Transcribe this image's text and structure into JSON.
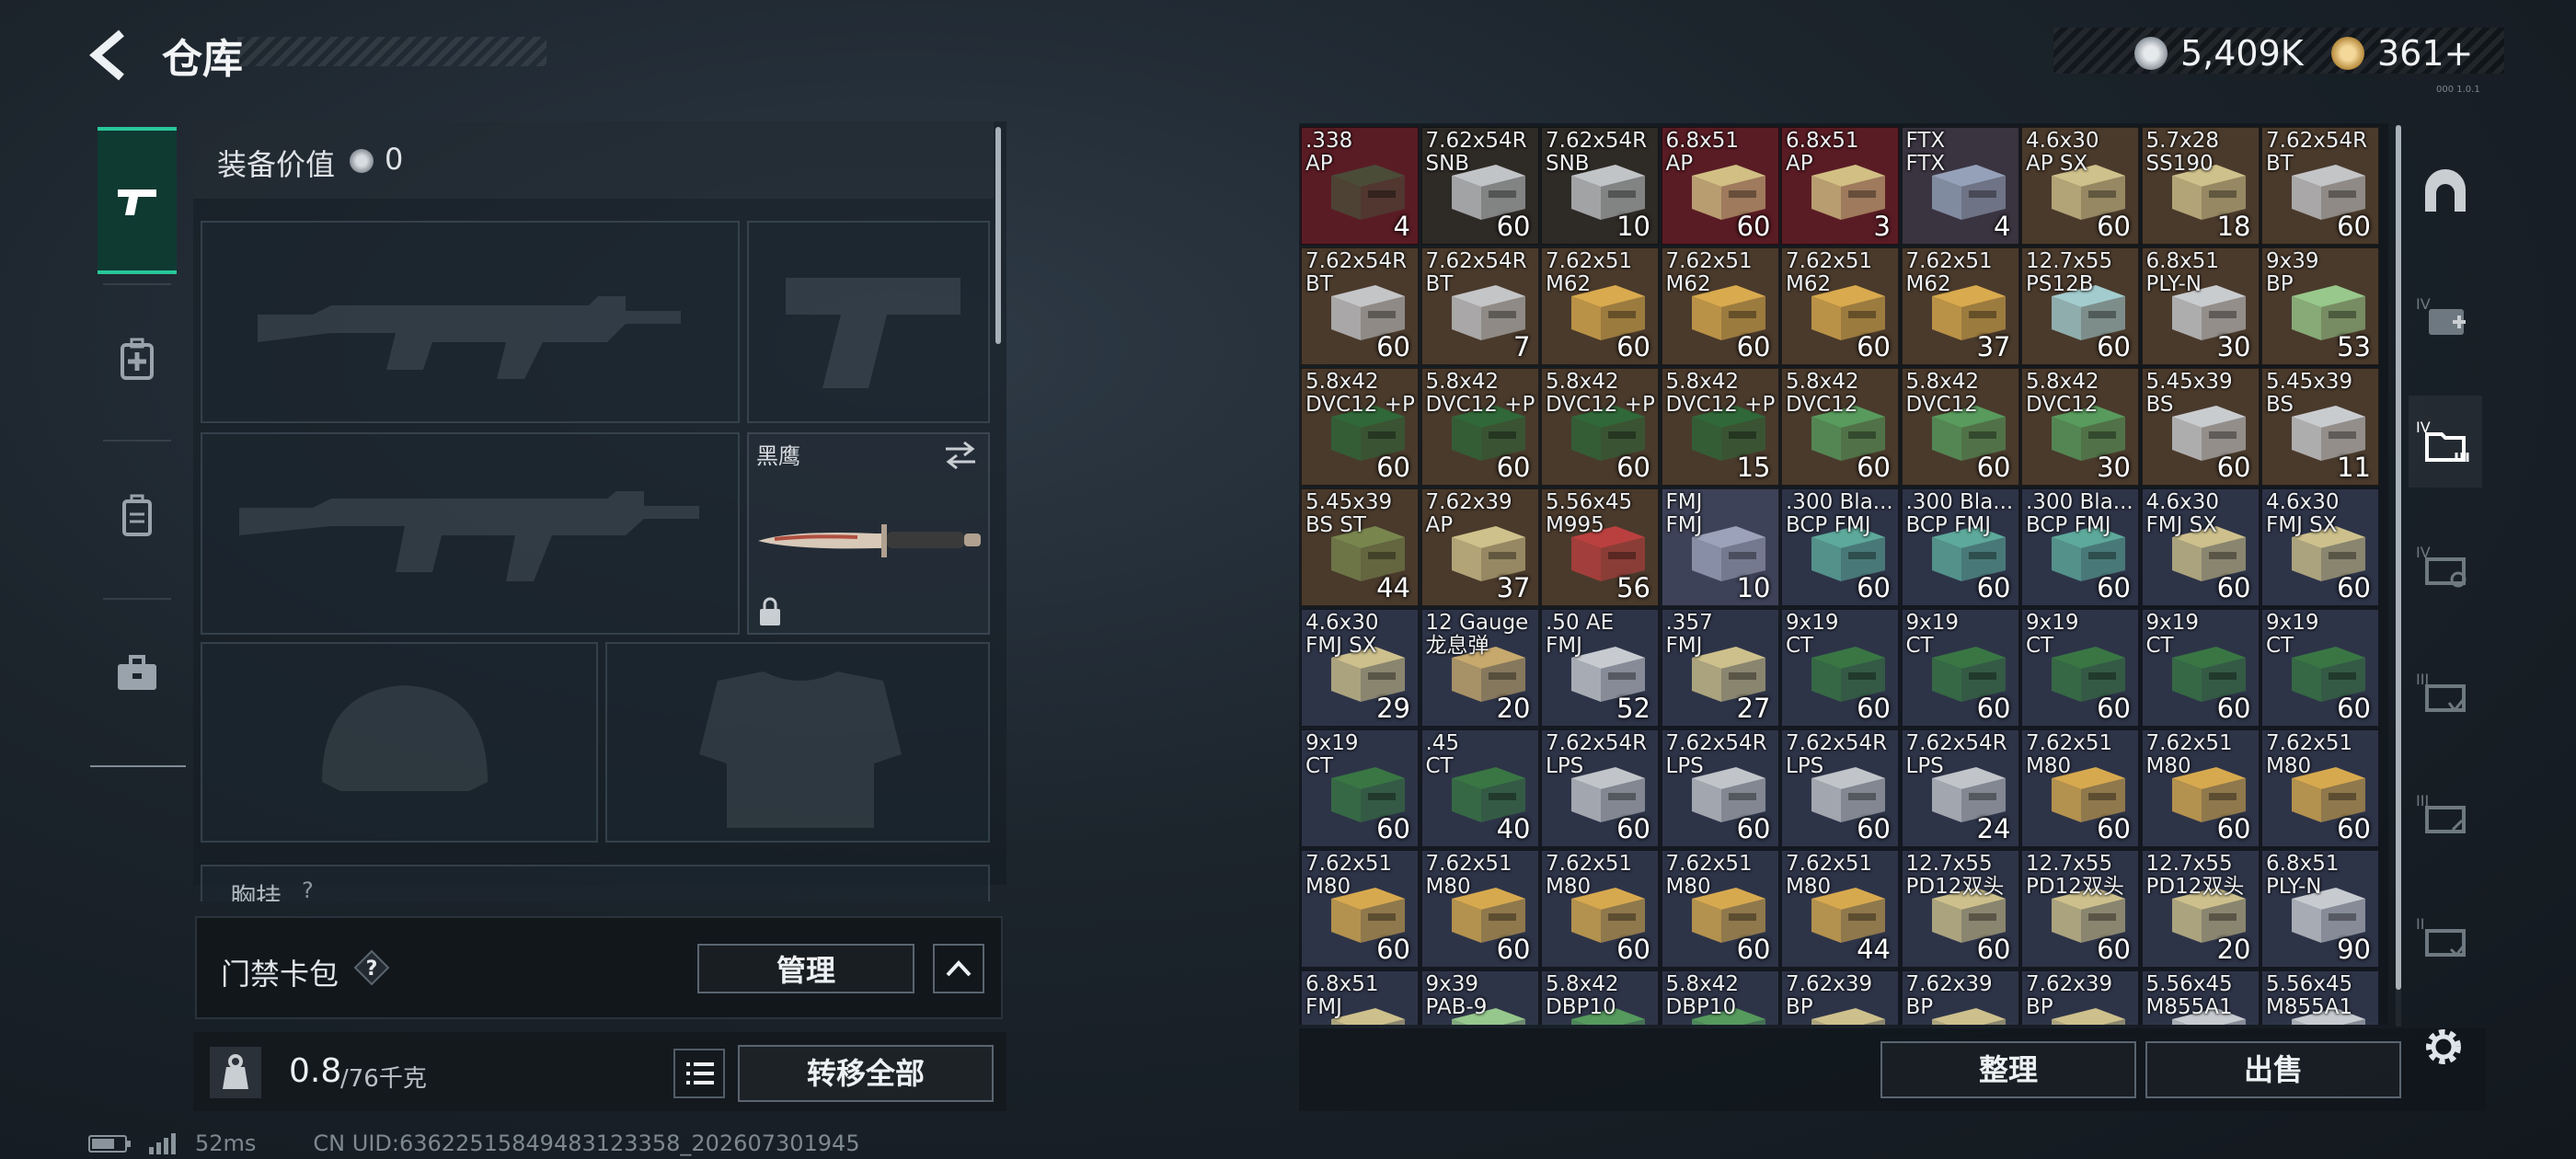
{
  "header": {
    "title": "仓库"
  },
  "currency": {
    "silver": "5,409K",
    "gold": "361+",
    "gold_add": "+"
  },
  "version": "000 1.0.1",
  "equipment": {
    "value_label": "装备价值",
    "value": "0",
    "knife_name": "黑鹰",
    "chest_label": "胸挂",
    "chest_help": "?"
  },
  "card_pack": {
    "label": "门禁卡包",
    "help": "?",
    "manage": "管理"
  },
  "weight": {
    "current": "0.8",
    "max": "/76千克"
  },
  "actions": {
    "transfer_all": "转移全部",
    "sort": "整理",
    "sell": "出售"
  },
  "status": {
    "ping": "52ms",
    "uid": "CN UID:63622515849483123358_202607301945"
  },
  "colors": {
    "accent": "#29c79a",
    "bg": "#1c242c"
  },
  "storage": {
    "items": [
      {
        "name": ".338\nAP",
        "qty": "4",
        "bg": "#5a1c24",
        "box": "#4a4f3a"
      },
      {
        "name": "7.62x54R\nSNB",
        "qty": "60",
        "bg": "#2e2a26",
        "box": "#c9ccd0"
      },
      {
        "name": "7.62x54R\nSNB",
        "qty": "10",
        "bg": "#2e2a26",
        "box": "#c9ccd0"
      },
      {
        "name": "6.8x51\nAP",
        "qty": "60",
        "bg": "#5a1c24",
        "box": "#d8c88a"
      },
      {
        "name": "6.8x51\nAP",
        "qty": "3",
        "bg": "#5a1c24",
        "box": "#d8c88a"
      },
      {
        "name": "FTX\nFTX",
        "qty": "4",
        "bg": "#3a3440",
        "box": "#9aa8c0"
      },
      {
        "name": "4.6x30\nAP SX",
        "qty": "60",
        "bg": "#4a3a2c",
        "box": "#d6c890"
      },
      {
        "name": "5.7x28\nSS190",
        "qty": "18",
        "bg": "#4a3a2c",
        "box": "#d6c890"
      },
      {
        "name": "7.62x54R\nBT",
        "qty": "60",
        "bg": "#4a3a2c",
        "box": "#c9ccd0"
      },
      {
        "name": "7.62x54R\nBT",
        "qty": "60",
        "bg": "#4a3a2c",
        "box": "#c9ccd0"
      },
      {
        "name": "7.62x54R\nBT",
        "qty": "7",
        "bg": "#4a3a2c",
        "box": "#c9ccd0"
      },
      {
        "name": "7.62x51\nM62",
        "qty": "60",
        "bg": "#4a3a2c",
        "box": "#e0b050"
      },
      {
        "name": "7.62x51\nM62",
        "qty": "60",
        "bg": "#4a3a2c",
        "box": "#e0b050"
      },
      {
        "name": "7.62x51\nM62",
        "qty": "60",
        "bg": "#4a3a2c",
        "box": "#e0b050"
      },
      {
        "name": "7.62x51\nM62",
        "qty": "37",
        "bg": "#4a3a2c",
        "box": "#e0b050"
      },
      {
        "name": "12.7x55\nPS12B",
        "qty": "60",
        "bg": "#4a3a2c",
        "box": "#a8d4d8"
      },
      {
        "name": "6.8x51\nPLY-N",
        "qty": "30",
        "bg": "#4a3a2c",
        "box": "#d0d4d8"
      },
      {
        "name": "9x39\nBP",
        "qty": "53",
        "bg": "#4a3a2c",
        "box": "#9cd090"
      },
      {
        "name": "5.8x42\nDVC12 +P",
        "qty": "60",
        "bg": "#4a3a2c",
        "box": "#2e6a3a"
      },
      {
        "name": "5.8x42\nDVC12 +P",
        "qty": "60",
        "bg": "#4a3a2c",
        "box": "#2e6a3a"
      },
      {
        "name": "5.8x42\nDVC12 +P",
        "qty": "60",
        "bg": "#4a3a2c",
        "box": "#2e6a3a"
      },
      {
        "name": "5.8x42\nDVC12 +P",
        "qty": "15",
        "bg": "#4a3a2c",
        "box": "#2e6a3a"
      },
      {
        "name": "5.8x42\nDVC12",
        "qty": "60",
        "bg": "#4a3a2c",
        "box": "#58a060"
      },
      {
        "name": "5.8x42\nDVC12",
        "qty": "60",
        "bg": "#4a3a2c",
        "box": "#58a060"
      },
      {
        "name": "5.8x42\nDVC12",
        "qty": "30",
        "bg": "#4a3a2c",
        "box": "#58a060"
      },
      {
        "name": "5.45x39\nBS",
        "qty": "60",
        "bg": "#4a3a2c",
        "box": "#d0d4d8"
      },
      {
        "name": "5.45x39\nBS",
        "qty": "11",
        "bg": "#4a3a2c",
        "box": "#d0d4d8"
      },
      {
        "name": "5.45x39\nBS ST",
        "qty": "44",
        "bg": "#4a3a2c",
        "box": "#7a8a50"
      },
      {
        "name": "7.62x39\nAP",
        "qty": "37",
        "bg": "#4a3a2c",
        "box": "#d6c890"
      },
      {
        "name": "5.56x45\nM995",
        "qty": "56",
        "bg": "#4a3a2c",
        "box": "#c04040"
      },
      {
        "name": "FMJ\nFMJ",
        "qty": "10",
        "bg": "#3e4258",
        "box": "#a0a8c0"
      },
      {
        "name": ".300 Bla...\nBCP FMJ",
        "qty": "60",
        "bg": "#2e3448",
        "box": "#60b0a0"
      },
      {
        "name": ".300 Bla...\nBCP FMJ",
        "qty": "60",
        "bg": "#2e3448",
        "box": "#60b0a0"
      },
      {
        "name": ".300 Bla...\nBCP FMJ",
        "qty": "60",
        "bg": "#2e3448",
        "box": "#60b0a0"
      },
      {
        "name": "4.6x30\nFMJ SX",
        "qty": "60",
        "bg": "#2e3448",
        "box": "#d6c890"
      },
      {
        "name": "4.6x30\nFMJ SX",
        "qty": "60",
        "bg": "#2e3448",
        "box": "#d6c890"
      },
      {
        "name": "4.6x30\nFMJ SX",
        "qty": "29",
        "bg": "#2e3448",
        "box": "#d6c890"
      },
      {
        "name": "12 Gauge\n龙息弹",
        "qty": "20",
        "bg": "#2e3448",
        "box": "#d0b070"
      },
      {
        "name": ".50 AE\nFMJ",
        "qty": "52",
        "bg": "#2e3448",
        "box": "#d0d4d8"
      },
      {
        "name": ".357\nFMJ",
        "qty": "27",
        "bg": "#2e3448",
        "box": "#d6c890"
      },
      {
        "name": "9x19\nCT",
        "qty": "60",
        "bg": "#2e3448",
        "box": "#3a7a44"
      },
      {
        "name": "9x19\nCT",
        "qty": "60",
        "bg": "#2e3448",
        "box": "#3a7a44"
      },
      {
        "name": "9x19\nCT",
        "qty": "60",
        "bg": "#2e3448",
        "box": "#3a7a44"
      },
      {
        "name": "9x19\nCT",
        "qty": "60",
        "bg": "#2e3448",
        "box": "#3a7a44"
      },
      {
        "name": "9x19\nCT",
        "qty": "60",
        "bg": "#2e3448",
        "box": "#3a7a44"
      },
      {
        "name": "9x19\nCT",
        "qty": "60",
        "bg": "#2e3448",
        "box": "#3a7a44"
      },
      {
        "name": ".45\nCT",
        "qty": "40",
        "bg": "#2e3448",
        "box": "#3a7a44"
      },
      {
        "name": "7.62x54R\nLPS",
        "qty": "60",
        "bg": "#2e3448",
        "box": "#c9ccd0"
      },
      {
        "name": "7.62x54R\nLPS",
        "qty": "60",
        "bg": "#2e3448",
        "box": "#c9ccd0"
      },
      {
        "name": "7.62x54R\nLPS",
        "qty": "60",
        "bg": "#2e3448",
        "box": "#c9ccd0"
      },
      {
        "name": "7.62x54R\nLPS",
        "qty": "24",
        "bg": "#2e3448",
        "box": "#c9ccd0"
      },
      {
        "name": "7.62x51\nM80",
        "qty": "60",
        "bg": "#2e3448",
        "box": "#e0b050"
      },
      {
        "name": "7.62x51\nM80",
        "qty": "60",
        "bg": "#2e3448",
        "box": "#e0b050"
      },
      {
        "name": "7.62x51\nM80",
        "qty": "60",
        "bg": "#2e3448",
        "box": "#e0b050"
      },
      {
        "name": "7.62x51\nM80",
        "qty": "60",
        "bg": "#2e3448",
        "box": "#e0b050"
      },
      {
        "name": "7.62x51\nM80",
        "qty": "60",
        "bg": "#2e3448",
        "box": "#e0b050"
      },
      {
        "name": "7.62x51\nM80",
        "qty": "60",
        "bg": "#2e3448",
        "box": "#e0b050"
      },
      {
        "name": "7.62x51\nM80",
        "qty": "60",
        "bg": "#2e3448",
        "box": "#e0b050"
      },
      {
        "name": "7.62x51\nM80",
        "qty": "44",
        "bg": "#2e3448",
        "box": "#e0b050"
      },
      {
        "name": "12.7x55\nPD12双头",
        "qty": "60",
        "bg": "#2e3448",
        "box": "#d6c890"
      },
      {
        "name": "12.7x55\nPD12双头",
        "qty": "60",
        "bg": "#2e3448",
        "box": "#d6c890"
      },
      {
        "name": "12.7x55\nPD12双头",
        "qty": "20",
        "bg": "#2e3448",
        "box": "#d6c890"
      },
      {
        "name": "6.8x51\nPLY-N",
        "qty": "90",
        "bg": "#2e3448",
        "box": "#d0d4d8"
      },
      {
        "name": "6.8x51\nFMJ",
        "qty": "",
        "bg": "#2e3448",
        "box": "#d6c890"
      },
      {
        "name": "9x39\nPAB-9",
        "qty": "",
        "bg": "#2e3448",
        "box": "#9cd090"
      },
      {
        "name": "5.8x42\nDBP10",
        "qty": "",
        "bg": "#2e3448",
        "box": "#58a060"
      },
      {
        "name": "5.8x42\nDBP10",
        "qty": "",
        "bg": "#2e3448",
        "box": "#58a060"
      },
      {
        "name": "7.62x39\nBP",
        "qty": "",
        "bg": "#2e3448",
        "box": "#d6c890"
      },
      {
        "name": "7.62x39\nBP",
        "qty": "",
        "bg": "#2e3448",
        "box": "#d6c890"
      },
      {
        "name": "7.62x39\nBP",
        "qty": "",
        "bg": "#2e3448",
        "box": "#d6c890"
      },
      {
        "name": "5.56x45\nM855A1",
        "qty": "",
        "bg": "#2e3448",
        "box": "#d0d4d8"
      },
      {
        "name": "5.56x45\nM855A1",
        "qty": "",
        "bg": "#2e3448",
        "box": "#d0d4d8"
      }
    ]
  }
}
